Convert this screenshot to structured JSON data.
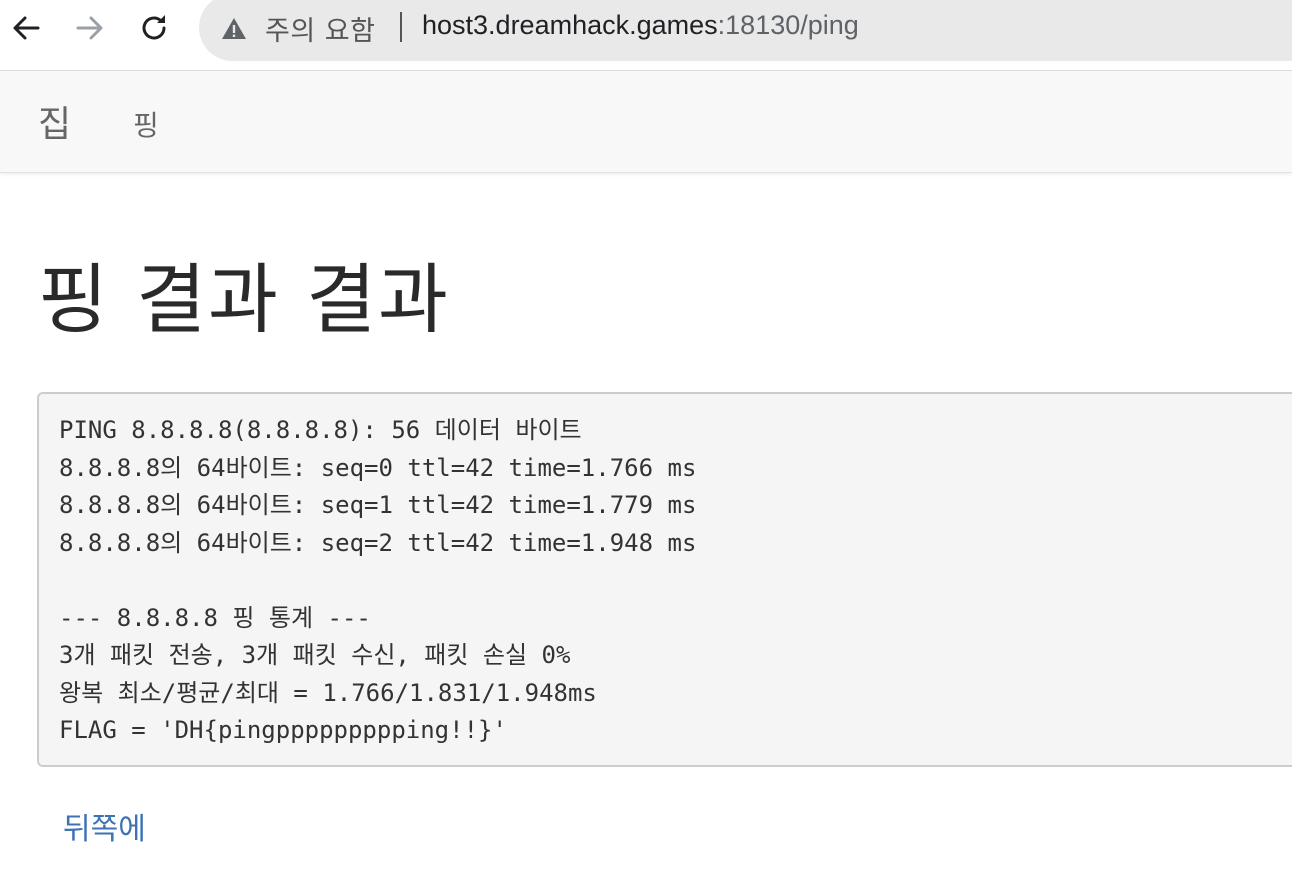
{
  "browser": {
    "security_label": "주의 요함",
    "url_host": "host3.dreamhack.games",
    "url_path": ":18130/ping",
    "back_icon": "arrow-left-icon",
    "forward_icon": "arrow-right-icon",
    "reload_icon": "reload-icon",
    "warning_icon": "warning-triangle-icon"
  },
  "navbar": {
    "home_label": "집",
    "ping_label": "핑"
  },
  "main": {
    "title": "핑 결과 결과",
    "result_lines": [
      "PING 8.8.8.8(8.8.8.8): 56 데이터 바이트",
      "8.8.8.8의 64바이트: seq=0 ttl=42 time=1.766 ms",
      "8.8.8.8의 64바이트: seq=1 ttl=42 time=1.779 ms",
      "8.8.8.8의 64바이트: seq=2 ttl=42 time=1.948 ms",
      "",
      "--- 8.8.8.8 핑 통계 ---",
      "3개 패킷 전송, 3개 패킷 수신, 패킷 손실 0%",
      "왕복 최소/평균/최대 = 1.766/1.831/1.948ms",
      "FLAG = 'DH{pingppppppppping!!}'"
    ],
    "back_label": "뒤쪽에"
  },
  "colors": {
    "link": "#3d72b4",
    "omnibox_bg": "#e9e9e9",
    "navbar_bg": "#f8f8f8",
    "pre_bg": "#f5f5f5"
  }
}
